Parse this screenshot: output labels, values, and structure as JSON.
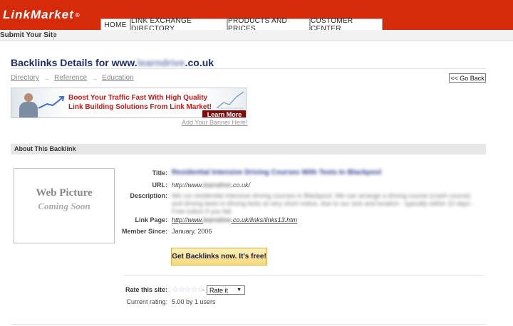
{
  "brand": {
    "logo_text": "LinkMarket",
    "logo_mark": "®",
    "accent": "#d62b0a",
    "title_color": "#1e2d6b"
  },
  "nav": {
    "tabs": [
      "HOME",
      "LINK EXCHANGE DIRECTORY",
      "PRODUCTS AND PRICES",
      "CUSTOMER CENTER"
    ]
  },
  "subnav": {
    "submit_label": "Submit Your Site"
  },
  "page": {
    "title_prefix": "Backlinks Details for www.",
    "title_blurred": "learndrive",
    "title_suffix": ".co.uk"
  },
  "breadcrumb": [
    "Directory",
    "Reference",
    "Education"
  ],
  "go_back_label": "<< Go Back",
  "banner": {
    "line1": "Boost Your Traffic Fast With High Quality",
    "line2": "Link Building Solutions  From Link Market!",
    "learn_more": "Learn More",
    "add_banner": "Add Your Banner Here!"
  },
  "section": {
    "title": "About This Backlink"
  },
  "web_picture": {
    "line1": "Web Picture",
    "line2": "Coming Soon"
  },
  "details": {
    "title_label": "Title:",
    "title_value": "Residential Intensive Driving Courses With Tests In Blackpool",
    "url_label": "URL:",
    "url_prefix": "http://www.",
    "url_blurred": "learndrive",
    "url_suffix": ".co.uk/",
    "description_label": "Description:",
    "description_value": "We run residential intensive driving courses in Blackpool. We can arrange a driving course (crash course) and driving tests in driving tests at very short notice, due to our size and location - typically within 10 days - Free tuition if you fail.",
    "link_page_label": "Link Page:",
    "link_page_prefix": "http://www.",
    "link_page_blurred": "learndrive",
    "link_page_suffix": ".co.uk/links/links13.htm",
    "member_since_label": "Member Since:",
    "member_since_value": "January, 2006"
  },
  "cta": {
    "label": "Get Backlinks now. It's free!"
  },
  "rating": {
    "rate_label": "Rate this site:",
    "select_value": "Rate it",
    "current_label": "Current rating:",
    "current_value": "5.00 by 1 users",
    "stars": 5
  }
}
